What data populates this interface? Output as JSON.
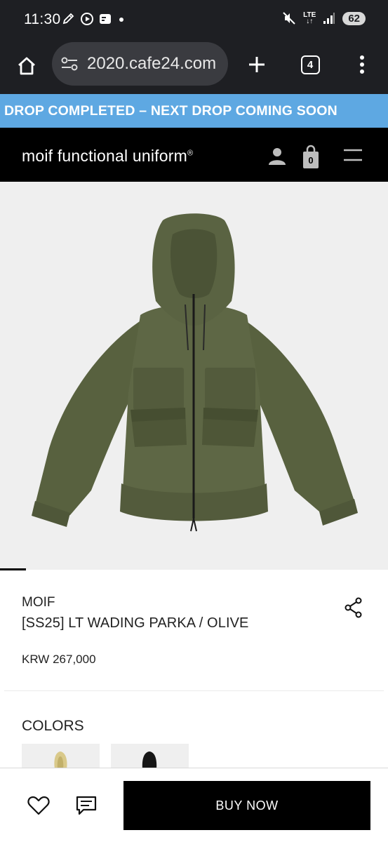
{
  "status_bar": {
    "time": "11:30",
    "network": "LTE",
    "battery": "62"
  },
  "browser": {
    "url": "2020.cafe24.com",
    "tab_count": "4"
  },
  "promo": {
    "text": "DROP COMPLETED – NEXT DROP COMING SOON",
    "color": "#5ea8e2"
  },
  "header": {
    "logo": "moif functional uniform",
    "logo_mark": "®",
    "cart_count": "0"
  },
  "product": {
    "brand": "MOIF",
    "name": "[SS25] LT WADING PARKA / OLIVE",
    "price": "KRW 267,000",
    "image_color": "#5b6344"
  },
  "colors": {
    "label": "COLORS",
    "swatches": [
      "olive-light",
      "black"
    ]
  },
  "actions": {
    "buy_label": "BUY NOW"
  }
}
